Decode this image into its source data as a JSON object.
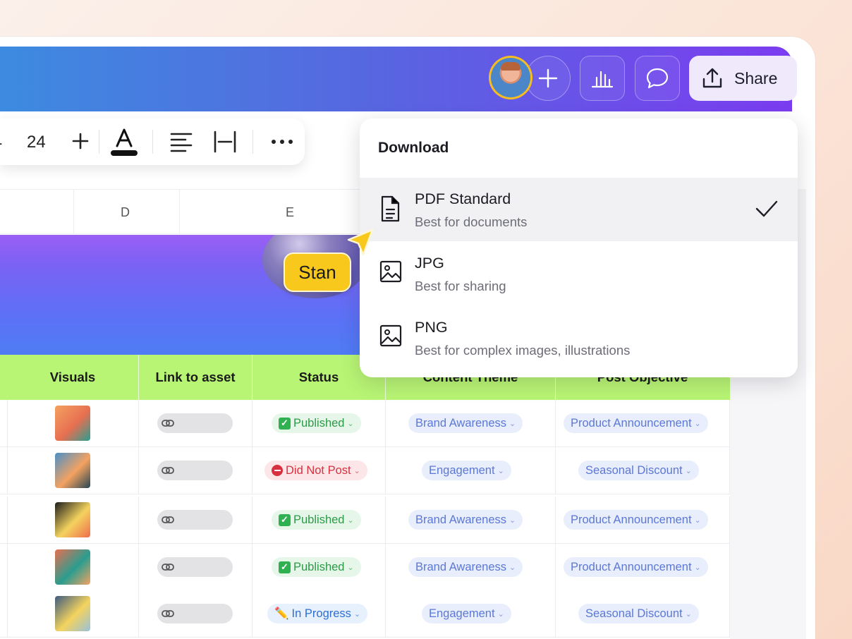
{
  "topbar": {
    "share_label": "Share",
    "icons": [
      "avatar",
      "plus-icon",
      "bar-chart-icon",
      "comment-icon",
      "upload-icon"
    ]
  },
  "toolbar": {
    "minus_label": "-",
    "font_size": "24",
    "icons": [
      "plus-icon",
      "text-color-icon",
      "align-left-icon",
      "letter-spacing-icon",
      "more-icon"
    ]
  },
  "columns": {
    "d": "D",
    "e": "E"
  },
  "collaborator": {
    "name": "Stan"
  },
  "table": {
    "headers": [
      "Visuals",
      "Link to asset",
      "Status",
      "Content Theme",
      "Post Objective"
    ],
    "rows": [
      {
        "status": "Published",
        "status_type": "published",
        "theme": "Brand Awareness",
        "objective": "Product Announcement"
      },
      {
        "status": "Did Not Post",
        "status_type": "notpost",
        "theme": "Engagement",
        "objective": "Seasonal Discount"
      },
      {
        "status": "Published",
        "status_type": "published",
        "theme": "Brand Awareness",
        "objective": "Product Announcement"
      },
      {
        "status": "Published",
        "status_type": "published",
        "theme": "Brand Awareness",
        "objective": "Product Announcement"
      },
      {
        "status": "In Progress",
        "status_type": "progress",
        "theme": "Engagement",
        "objective": "Seasonal Discount"
      }
    ]
  },
  "download_menu": {
    "title": "Download",
    "items": [
      {
        "name": "PDF Standard",
        "desc": "Best for documents",
        "selected": true
      },
      {
        "name": "JPG",
        "desc": "Best for sharing",
        "selected": false
      },
      {
        "name": "PNG",
        "desc": "Best for complex images, illustrations",
        "selected": false
      }
    ]
  },
  "colors": {
    "accent_gradient_start": "#3d8be0",
    "accent_gradient_end": "#7b3cf0",
    "header_green": "#b8f574",
    "collaborator_yellow": "#f8c81d"
  }
}
